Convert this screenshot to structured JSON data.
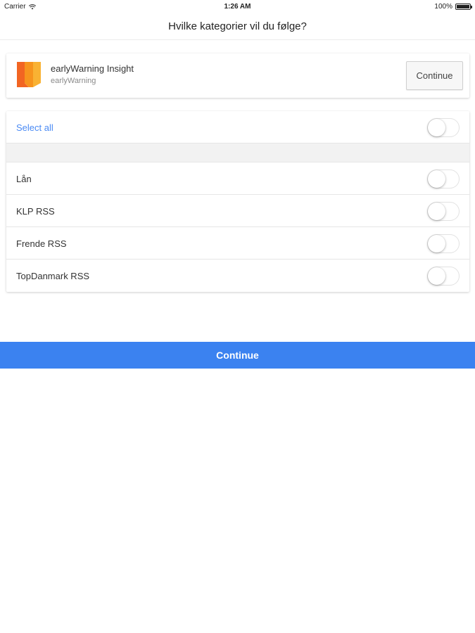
{
  "status_bar": {
    "carrier": "Carrier",
    "time": "1:26 AM",
    "battery": "100%",
    "icons": [
      "wifi-icon",
      "battery-icon"
    ]
  },
  "header": {
    "title": "Hvilke kategorier vil du følge?"
  },
  "app_card": {
    "name": "earlyWarning Insight",
    "publisher": "earlyWarning",
    "continue_label": "Continue",
    "logo_colors": [
      "#f7a21b",
      "#f26522",
      "#f9c23c"
    ]
  },
  "categories": {
    "select_all_label": "Select all",
    "select_all_on": false,
    "items": [
      {
        "label": "Lån",
        "on": false
      },
      {
        "label": "KLP RSS",
        "on": false
      },
      {
        "label": "Frende RSS",
        "on": false
      },
      {
        "label": "TopDanmark RSS",
        "on": false
      }
    ]
  },
  "footer": {
    "continue_label": "Continue"
  },
  "colors": {
    "accent": "#3b82f0",
    "link": "#4a8af4"
  }
}
